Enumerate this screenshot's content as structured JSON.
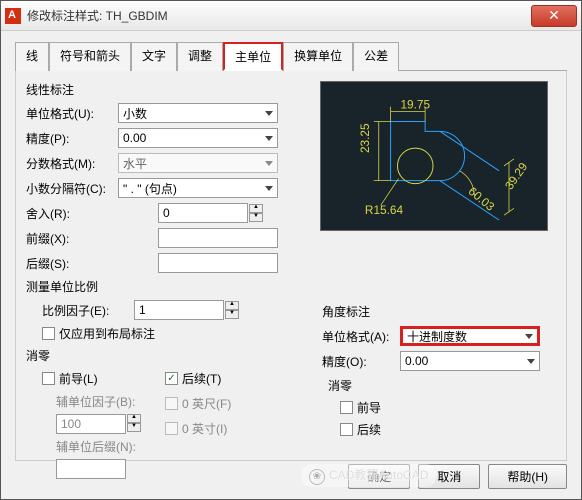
{
  "title": "修改标注样式: TH_GBDIM",
  "tabs": [
    "线",
    "符号和箭头",
    "文字",
    "调整",
    "主单位",
    "换算单位",
    "公差"
  ],
  "active_tab": 4,
  "linear": {
    "group": "线性标注",
    "unit_label": "单位格式(U):",
    "unit_value": "小数",
    "precision_label": "精度(P):",
    "precision_value": "0.00",
    "fraction_label": "分数格式(M):",
    "fraction_value": "水平",
    "decsep_label": "小数分隔符(C):",
    "decsep_value": "\" . \"  (句点)",
    "round_label": "舍入(R):",
    "round_value": "0",
    "prefix_label": "前缀(X):",
    "prefix_value": "",
    "suffix_label": "后缀(S):",
    "suffix_value": ""
  },
  "scale": {
    "group": "测量单位比例",
    "factor_label": "比例因子(E):",
    "factor_value": "1",
    "layout_only": "仅应用到布局标注"
  },
  "zero": {
    "group": "消零",
    "leading": "前导(L)",
    "trailing": "后续(T)",
    "subfactor_label": "辅单位因子(B):",
    "subfactor_value": "100",
    "subsuffix_label": "辅单位后缀(N):",
    "feet": "0 英尺(F)",
    "inches": "0 英寸(I)"
  },
  "angular": {
    "group": "角度标注",
    "format_label": "单位格式(A):",
    "format_value": "十进制度数",
    "precision_label": "精度(O):",
    "precision_value": "0.00",
    "zero_group": "消零",
    "leading": "前导",
    "trailing": "后续"
  },
  "preview_dims": {
    "w": "19.75",
    "h": "23.25",
    "r": "R15.64",
    "ang": "60.03",
    "diag": "39.29"
  },
  "buttons": {
    "ok": "确定",
    "cancel": "取消",
    "help": "帮助(H)"
  },
  "watermark": "CAD教程AutoCAD"
}
